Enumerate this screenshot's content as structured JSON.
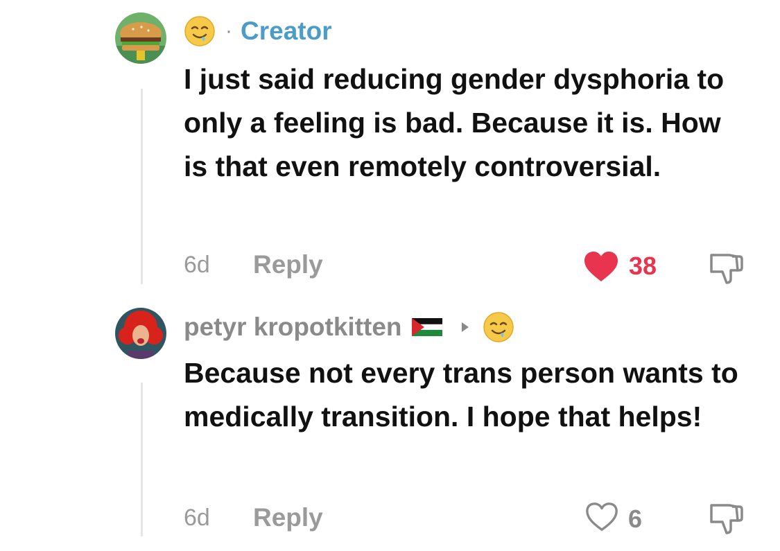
{
  "colors": {
    "creator_accent": "#4b9cc9",
    "like_active": "#e8344e",
    "muted_text": "#8a8a8a",
    "body_text": "#111111"
  },
  "comments": [
    {
      "avatar_icon": "burger-avatar-icon",
      "emoji_icon": "drooling-face-emoji",
      "separator": "·",
      "badge": "Creator",
      "text": "I just said reducing gender dysphoria to only a feeling is bad. Because it is. How is that even remotely controversial.",
      "time": "6d",
      "reply_label": "Reply",
      "like_count": "38",
      "liked": true
    },
    {
      "avatar_icon": "red-hair-avatar-icon",
      "username": "petyr kropotkitten",
      "flag_icon": "palestine-flag-icon",
      "reply_to_icon": "drooling-face-emoji",
      "text": "Because not every trans person wants to medically transition. I hope that helps!",
      "time": "6d",
      "reply_label": "Reply",
      "like_count": "6",
      "liked": false
    }
  ]
}
